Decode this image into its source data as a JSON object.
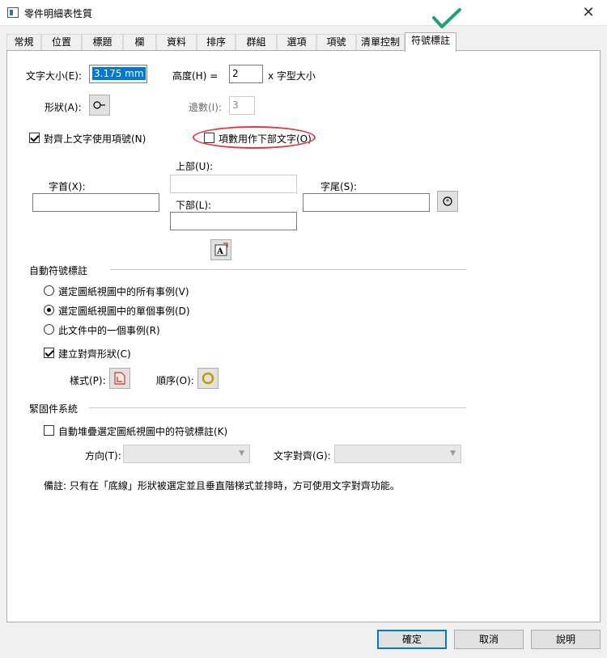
{
  "window": {
    "title": "零件明細表性質",
    "close_glyph": "✕"
  },
  "tabs": [
    "常規",
    "位置",
    "標題",
    "欄",
    "資料",
    "排序",
    "群組",
    "選項",
    "項號",
    "清單控制",
    "符號標註"
  ],
  "text_size": {
    "label": "文字大小(E):",
    "value": "3.175 mm"
  },
  "height": {
    "label": "高度(H) =",
    "value": "2",
    "suffix": "x 字型大小"
  },
  "shape": {
    "label": "形狀(A):"
  },
  "sides": {
    "label": "邊數(I):",
    "value": "3"
  },
  "align_upper": {
    "label": "對齊上文字使用項號(N)",
    "checked": true
  },
  "item_lower": {
    "label": "項數用作下部文字(O)",
    "checked": false
  },
  "prefix": {
    "label": "字首(X):",
    "value": ""
  },
  "upper": {
    "label": "上部(U):",
    "value": ""
  },
  "lower": {
    "label": "下部(L):",
    "value": ""
  },
  "suffix": {
    "label": "字尾(S):",
    "value": ""
  },
  "auto_balloon": {
    "header": "自動符號標註",
    "options": [
      {
        "label": "選定圖紙視圖中的所有事例(V)",
        "selected": false
      },
      {
        "label": "選定圖紙視圖中的單個事例(D)",
        "selected": true
      },
      {
        "label": "此文件中的一個事例(R)",
        "selected": false
      }
    ],
    "create_align": {
      "label": "建立對齊形狀(C)",
      "checked": true
    },
    "style_label": "樣式(P):",
    "order_label": "順序(O):"
  },
  "fastener": {
    "header": "緊固件系統",
    "auto_stack": {
      "label": "自動堆疊選定圖紙視圖中的符號標註(K)",
      "checked": false
    },
    "direction_label": "方向(T):",
    "text_align_label": "文字對齊(G):",
    "note": "備註: 只有在「底線」形狀被選定並且垂直階梯式並排時，方可使用文字對齊功能。"
  },
  "buttons": {
    "ok": "確定",
    "cancel": "取消",
    "help": "說明"
  },
  "colors": {
    "accent": "#0078d7",
    "annotation_red": "#e0393e",
    "checkmark_teal": "#1aa37a"
  }
}
